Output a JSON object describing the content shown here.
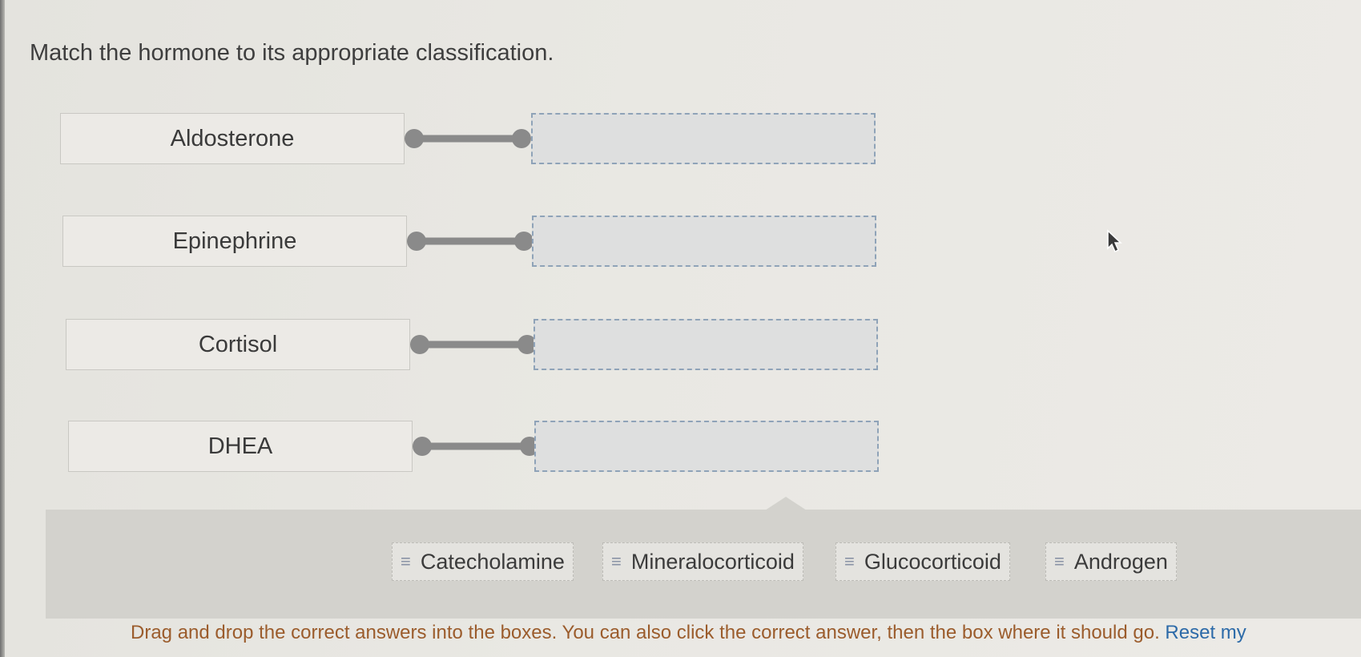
{
  "prompt": "Match the hormone to its appropriate classification.",
  "matches": [
    {
      "hormone": "Aldosterone"
    },
    {
      "hormone": "Epinephrine"
    },
    {
      "hormone": "Cortisol"
    },
    {
      "hormone": "DHEA"
    }
  ],
  "answers": [
    {
      "label": "Catecholamine"
    },
    {
      "label": "Mineralocorticoid"
    },
    {
      "label": "Glucocorticoid"
    },
    {
      "label": "Androgen"
    }
  ],
  "instructions": {
    "text": "Drag and drop the correct answers into the boxes. You can also click the correct answer, then the box where it should go.",
    "reset_link": "Reset my"
  },
  "icons": {
    "grip": "drag-handle-icon",
    "connector": "connector-icon",
    "cursor": "mouse-pointer-icon"
  },
  "colors": {
    "connector": "#8a8a8a",
    "drop_border": "#8fa3b8",
    "instructions": "#9b5c2c",
    "link": "#2c6aa8"
  }
}
